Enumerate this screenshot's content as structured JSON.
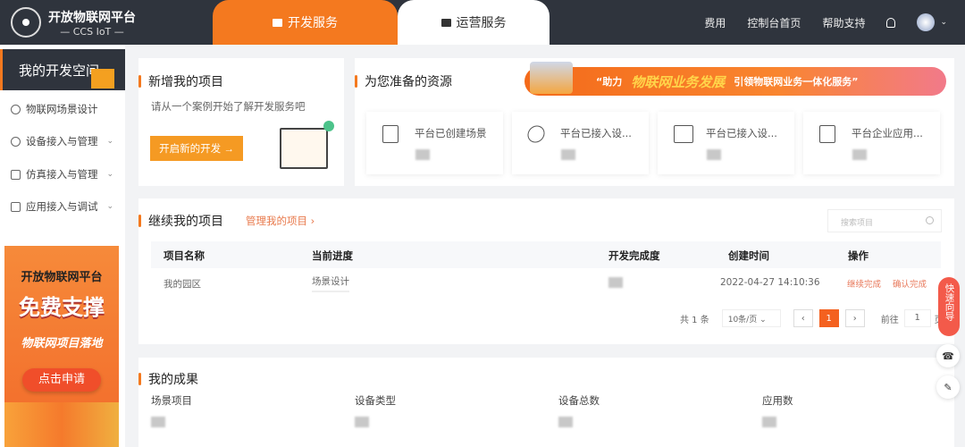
{
  "header": {
    "logo_title": "开放物联网平台",
    "logo_sub": "— CCS IoT —",
    "tabs": [
      {
        "label": "开发服务",
        "active": true
      },
      {
        "label": "运营服务",
        "active": false
      }
    ],
    "nav": [
      "费用",
      "控制台首页",
      "帮助支持"
    ]
  },
  "sidebar": {
    "space_title": "我的开发空间",
    "items": [
      {
        "label": "物联网场景设计"
      },
      {
        "label": "设备接入与管理"
      },
      {
        "label": "仿真接入与管理"
      },
      {
        "label": "应用接入与调试"
      }
    ],
    "promo": {
      "line1": "开放物联网平台",
      "line2": "免费支撑",
      "line3": "物联网项目落地",
      "button": "点击申请"
    }
  },
  "new_project": {
    "title": "新增我的项目",
    "subtitle": "请从一个案例开始了解开发服务吧",
    "button": "开启新的开发 →"
  },
  "resources": {
    "title": "为您准备的资源",
    "banner": {
      "prefix": "“助力",
      "highlight": "物联网业务发展",
      "suffix": "引领物联网业务一体化服务”"
    },
    "items": [
      {
        "label": "平台已创建场景"
      },
      {
        "label": "平台已接入设..."
      },
      {
        "label": "平台已接入设..."
      },
      {
        "label": "平台企业应用..."
      }
    ]
  },
  "continue": {
    "title": "继续我的项目",
    "manage_link": "管理我的项目 ›",
    "search_placeholder": "搜索项目",
    "columns": [
      "项目名称",
      "当前进度",
      "开发完成度",
      "创建时间",
      "操作"
    ],
    "rows": [
      {
        "name": "我的园区",
        "progress": "场景设计",
        "created": "2022-04-27 14:10:36",
        "actions": [
          "继续完成",
          "确认完成"
        ]
      }
    ],
    "pagination": {
      "total": "共 1 条",
      "page_size": "10条/页",
      "current": "1",
      "goto_label": "前往",
      "goto_value": "1",
      "page_suffix": "页"
    }
  },
  "results": {
    "title": "我的成果",
    "items": [
      {
        "label": "场景项目"
      },
      {
        "label": "设备类型"
      },
      {
        "label": "设备总数"
      },
      {
        "label": "应用数"
      }
    ]
  },
  "float": {
    "guide": "快速向导"
  },
  "colors": {
    "accent": "#f4791f",
    "header_bg": "#2f343d"
  }
}
